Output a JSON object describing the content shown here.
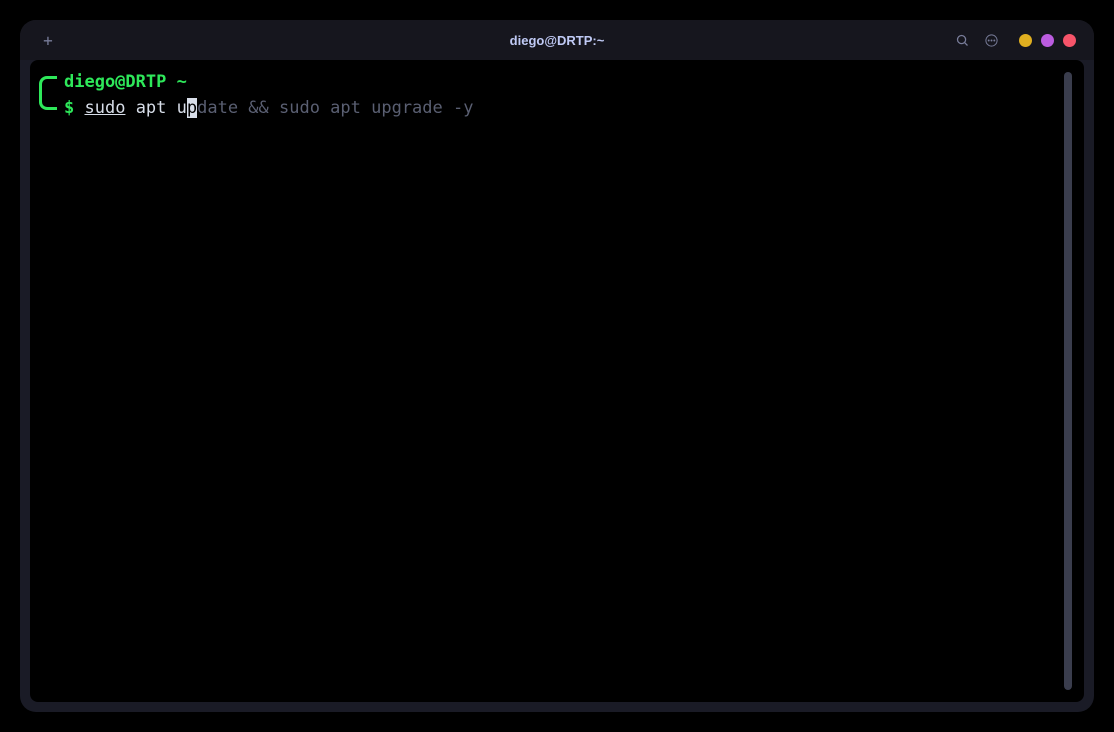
{
  "window": {
    "title": "diego@DRTP:~"
  },
  "prompt": {
    "user_host": "diego@DRTP",
    "path": "~",
    "symbol": "$"
  },
  "command": {
    "sudo": "sudo",
    "typed_after_sudo": " apt u",
    "cursor_char": "p",
    "suggestion": "date && sudo apt upgrade -y"
  },
  "colors": {
    "prompt_green": "#2ee85a",
    "text": "#d8dee9",
    "suggestion": "#5a5f72",
    "titlebar_bg": "#16161e",
    "window_bg": "#1a1b26",
    "terminal_bg": "#000000"
  }
}
